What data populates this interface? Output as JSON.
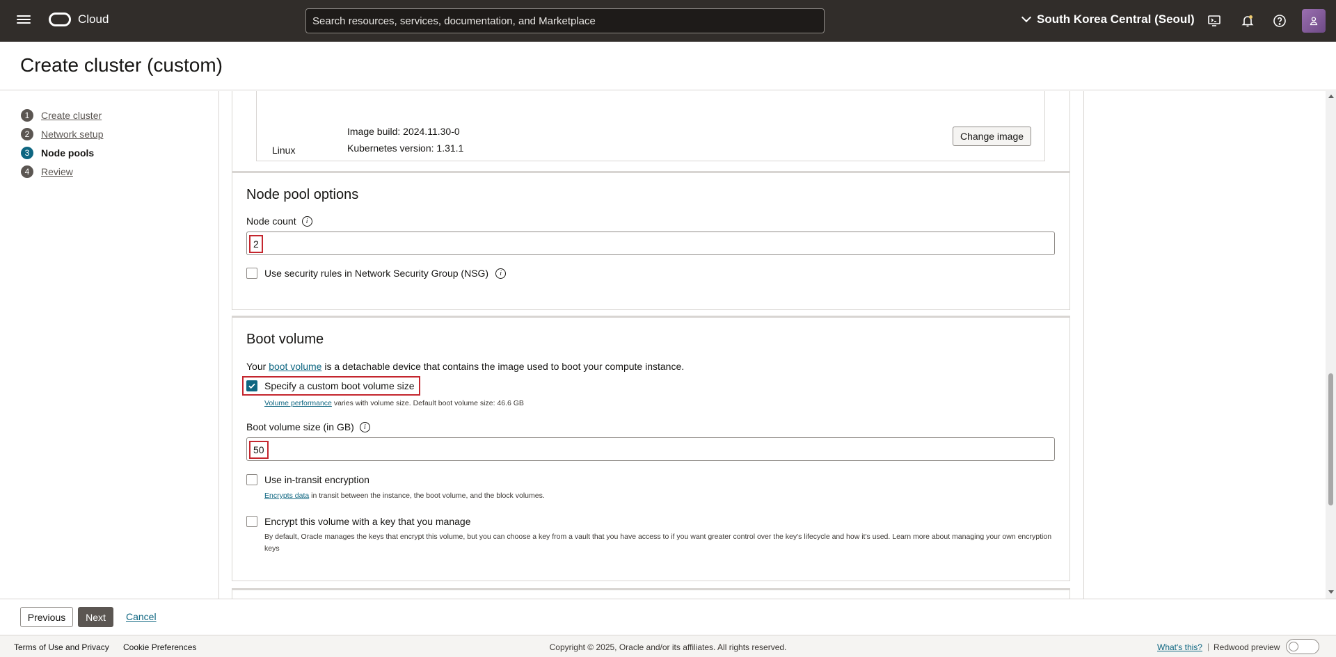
{
  "topbar": {
    "brand": "Cloud",
    "search_placeholder": "Search resources, services, documentation, and Marketplace",
    "region": "South Korea Central (Seoul)"
  },
  "page": {
    "title": "Create cluster (custom)"
  },
  "steps": [
    {
      "num": "1",
      "label": "Create cluster"
    },
    {
      "num": "2",
      "label": "Network setup"
    },
    {
      "num": "3",
      "label": "Node pools"
    },
    {
      "num": "4",
      "label": "Review"
    }
  ],
  "image_card": {
    "os": "Linux",
    "image_build": "Image build: 2024.11.30-0",
    "kubernetes_version": "Kubernetes version: 1.31.1",
    "change_button": "Change image"
  },
  "node_pool_options": {
    "title": "Node pool options",
    "node_count_label": "Node count",
    "node_count_value": "2",
    "nsg_label": "Use security rules in Network Security Group (NSG)"
  },
  "boot_volume": {
    "title": "Boot volume",
    "desc_prefix": "Your",
    "desc_link": "boot volume",
    "desc_suffix": "is a detachable device that contains the image used to boot your compute instance.",
    "custom_size_label": "Specify a custom boot volume size",
    "perf_link": "Volume performance",
    "perf_text": "varies with volume size. Default boot volume size: 46.6 GB",
    "size_label": "Boot volume size (in GB)",
    "size_value": "50",
    "in_transit_label": "Use in-transit encryption",
    "encrypts_link": "Encrypts data",
    "encrypts_text": "in transit between the instance, the boot volume, and the block volumes.",
    "key_label": "Encrypt this volume with a key that you manage",
    "key_help": "By default, Oracle manages the keys that encrypt this volume, but you can choose a key from a vault that you have access to if you want greater control over the key's lifecycle and how it's used.",
    "key_link": "Learn more about managing your own encryption keys"
  },
  "actions": {
    "previous": "Previous",
    "next": "Next",
    "cancel": "Cancel"
  },
  "footer": {
    "terms": "Terms of Use and Privacy",
    "cookies": "Cookie Preferences",
    "copyright": "Copyright © 2025, Oracle and/or its affiliates. All rights reserved.",
    "whats_this": "What's this?",
    "separator": "|",
    "redwood": "Redwood preview"
  },
  "icons": {
    "menu": "hamburger-menu-icon",
    "logo": "oracle-logo-icon",
    "region_chevron": "chevron-down-icon",
    "cloud_shell": "cloud-shell-icon",
    "notifications": "bell-icon",
    "help": "help-icon",
    "profile": "user-icon",
    "info": "info-icon",
    "checkmark": "check-icon"
  },
  "colors": {
    "topbar": "#312d2a",
    "link": "#0e6681",
    "active_step": "#0e6681",
    "highlight": "#c4262e",
    "next_button": "#5b5652"
  }
}
